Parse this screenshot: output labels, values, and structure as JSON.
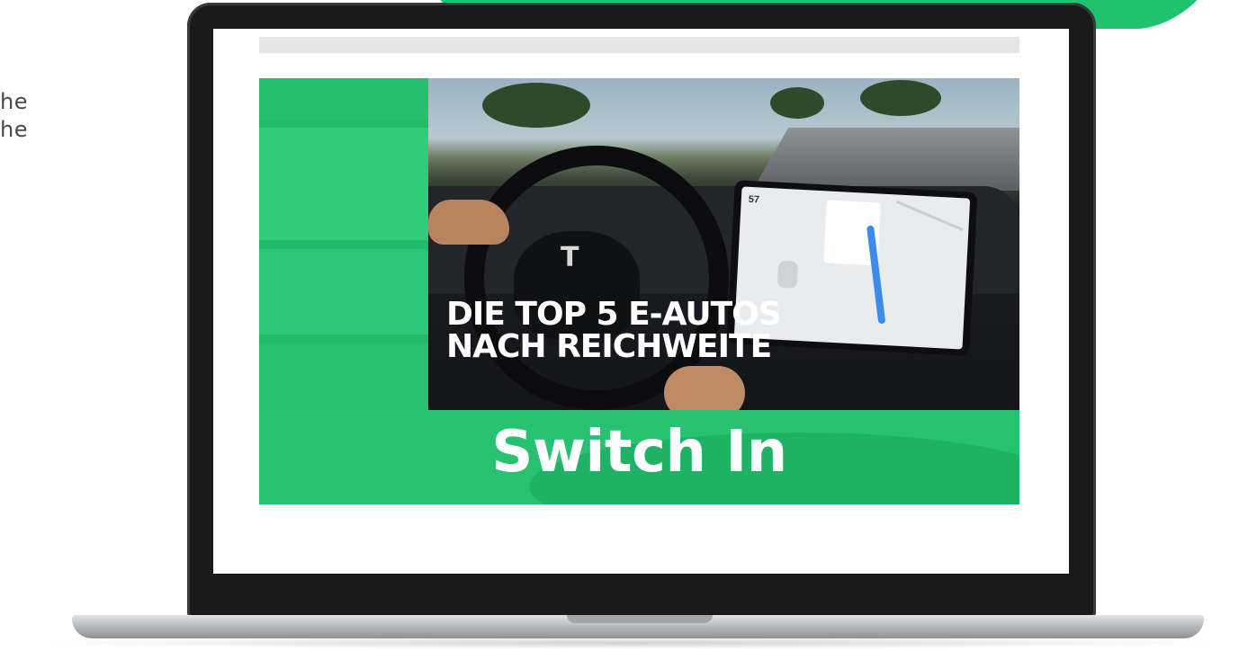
{
  "side_text": [
    "he",
    "he"
  ],
  "video": {
    "headline_line1": "DIE TOP 5 E-AUTOS",
    "headline_line2": "NACH REICHWEITE",
    "brand": "Switch In",
    "tablet_speed": "57",
    "car_logo": "T"
  },
  "colors": {
    "accent_green": "#22b96a",
    "bezel": "#1a1a1a",
    "loading_bar": "#e6e6e6"
  }
}
